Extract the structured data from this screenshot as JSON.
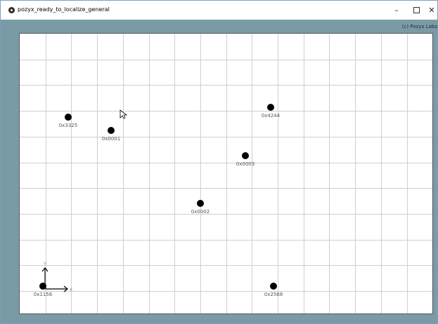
{
  "window": {
    "title": "pozyx_ready_to_localize_general",
    "minimize_glyph": "–",
    "close_glyph": "✕"
  },
  "copyright": "(c) Pozyx Labs",
  "axes": {
    "x_label": "X",
    "y_label": "Y"
  },
  "anchors": [
    {
      "id": "0x3325"
    },
    {
      "id": "0x0001"
    },
    {
      "id": "0x4244"
    },
    {
      "id": "0x0003"
    },
    {
      "id": "0x0002"
    },
    {
      "id": "0x1156"
    },
    {
      "id": "0x2568"
    }
  ],
  "icons": {
    "app": "pozyx-app-icon",
    "cursor": "mouse-pointer-icon"
  }
}
